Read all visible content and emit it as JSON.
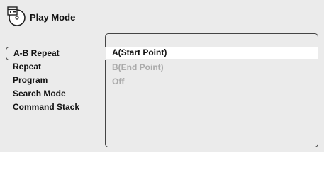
{
  "header": {
    "title": "Play Mode",
    "icon": "disc-settings-icon"
  },
  "menu": {
    "items": [
      {
        "label": "A-B Repeat",
        "selected": true
      },
      {
        "label": "Repeat",
        "selected": false
      },
      {
        "label": "Program",
        "selected": false
      },
      {
        "label": "Search Mode",
        "selected": false
      },
      {
        "label": "Command Stack",
        "selected": false
      }
    ]
  },
  "options": {
    "items": [
      {
        "label": "A(Start Point)",
        "state": "highlighted"
      },
      {
        "label": "B(End Point)",
        "state": "disabled"
      },
      {
        "label": "Off",
        "state": "disabled"
      }
    ]
  },
  "colors": {
    "background": "#ebebeb",
    "highlight": "#ffffff",
    "border": "#444444",
    "disabled_text": "#aaaaaa",
    "text": "#111111"
  }
}
